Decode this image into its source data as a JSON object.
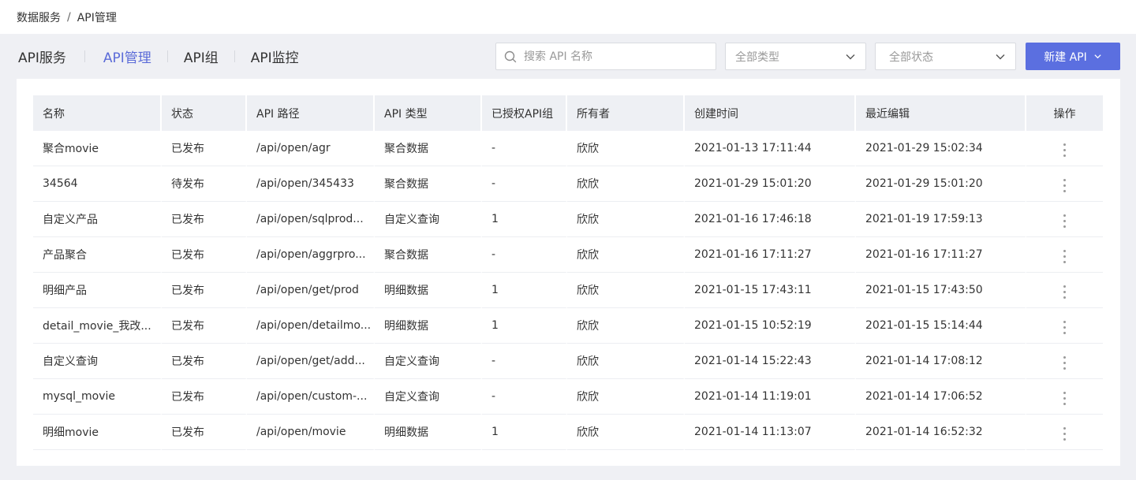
{
  "breadcrumb": {
    "parent": "数据服务",
    "separator": "/",
    "current": "API管理"
  },
  "tabs": [
    {
      "label": "API服务",
      "active": false
    },
    {
      "label": "API管理",
      "active": true
    },
    {
      "label": "API组",
      "active": false
    },
    {
      "label": "API监控",
      "active": false
    }
  ],
  "search": {
    "placeholder": "搜索 API 名称",
    "value": ""
  },
  "filters": {
    "type_label": "全部类型",
    "status_label": "全部状态"
  },
  "new_button": {
    "label": "新建 API"
  },
  "colors": {
    "accent": "#5b6fe0",
    "active_tab": "#5b6bd8",
    "header_bg": "#eef0f4"
  },
  "table": {
    "columns": [
      "名称",
      "状态",
      "API 路径",
      "API 类型",
      "已授权API组",
      "所有者",
      "创建时间",
      "最近编辑",
      "操作"
    ],
    "rows": [
      [
        "聚合movie",
        "已发布",
        "/api/open/agr",
        "聚合数据",
        "-",
        "欣欣",
        "2021-01-13 17:11:44",
        "2021-01-29 15:02:34"
      ],
      [
        "34564",
        "待发布",
        "/api/open/345433",
        "聚合数据",
        "-",
        "欣欣",
        "2021-01-29 15:01:20",
        "2021-01-29 15:01:20"
      ],
      [
        "自定义产品",
        "已发布",
        "/api/open/sqlprod...",
        "自定义查询",
        "1",
        "欣欣",
        "2021-01-16 17:46:18",
        "2021-01-19 17:59:13"
      ],
      [
        "产品聚合",
        "已发布",
        "/api/open/aggrpro...",
        "聚合数据",
        "-",
        "欣欣",
        "2021-01-16 17:11:27",
        "2021-01-16 17:11:27"
      ],
      [
        "明细产品",
        "已发布",
        "/api/open/get/prod",
        "明细数据",
        "1",
        "欣欣",
        "2021-01-15 17:43:11",
        "2021-01-15 17:43:50"
      ],
      [
        "detail_movie_我改...",
        "已发布",
        "/api/open/detailmo...",
        "明细数据",
        "1",
        "欣欣",
        "2021-01-15 10:52:19",
        "2021-01-15 15:14:44"
      ],
      [
        "自定义查询",
        "已发布",
        "/api/open/get/add...",
        "自定义查询",
        "-",
        "欣欣",
        "2021-01-14 15:22:43",
        "2021-01-14 17:08:12"
      ],
      [
        "mysql_movie",
        "已发布",
        "/api/open/custom-...",
        "自定义查询",
        "-",
        "欣欣",
        "2021-01-14 11:19:01",
        "2021-01-14 17:06:52"
      ],
      [
        "明细movie",
        "已发布",
        "/api/open/movie",
        "明细数据",
        "1",
        "欣欣",
        "2021-01-14 11:13:07",
        "2021-01-14 16:52:32"
      ]
    ]
  }
}
